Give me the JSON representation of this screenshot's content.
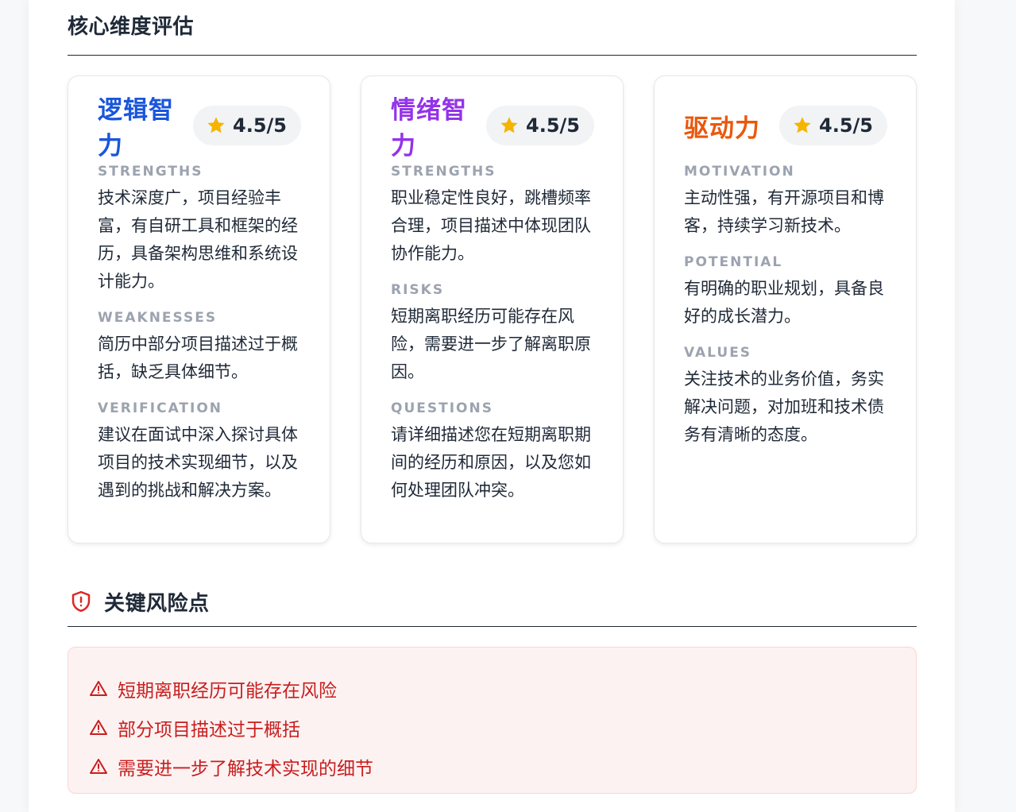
{
  "section_core": {
    "title": "核心维度评估"
  },
  "cards": [
    {
      "title": "逻辑智力",
      "color": "#1a56db",
      "rating": "4.5/5",
      "sections": [
        {
          "label": "STRENGTHS",
          "text": "技术深度广，项目经验丰富，有自研工具和框架的经历，具备架构思维和系统设计能力。"
        },
        {
          "label": "WEAKNESSES",
          "text": "简历中部分项目描述过于概括，缺乏具体细节。"
        },
        {
          "label": "VERIFICATION",
          "text": "建议在面试中深入探讨具体项目的技术实现细节，以及遇到的挑战和解决方案。"
        }
      ]
    },
    {
      "title": "情绪智力",
      "color": "#9333ea",
      "rating": "4.5/5",
      "sections": [
        {
          "label": "STRENGTHS",
          "text": "职业稳定性良好，跳槽频率合理，项目描述中体现团队协作能力。"
        },
        {
          "label": "RISKS",
          "text": "短期离职经历可能存在风险，需要进一步了解离职原因。"
        },
        {
          "label": "QUESTIONS",
          "text": "请详细描述您在短期离职期间的经历和原因，以及您如何处理团队冲突。"
        }
      ]
    },
    {
      "title": "驱动力",
      "color": "#ea580c",
      "rating": "4.5/5",
      "sections": [
        {
          "label": "MOTIVATION",
          "text": "主动性强，有开源项目和博客，持续学习新技术。"
        },
        {
          "label": "POTENTIAL",
          "text": "有明确的职业规划，具备良好的成长潜力。"
        },
        {
          "label": "VALUES",
          "text": "关注技术的业务价值，务实解决问题，对加班和技术债务有清晰的态度。"
        }
      ]
    }
  ],
  "section_risks": {
    "title": "关键风险点",
    "icon": "shield-alert-icon",
    "items": [
      "短期离职经历可能存在风险",
      "部分项目描述过于概括",
      "需要进一步了解技术实现的细节"
    ]
  },
  "colors": {
    "star": "#f5b400",
    "risk_text": "#c81e1e",
    "risk_bg": "#fdf2f2"
  }
}
